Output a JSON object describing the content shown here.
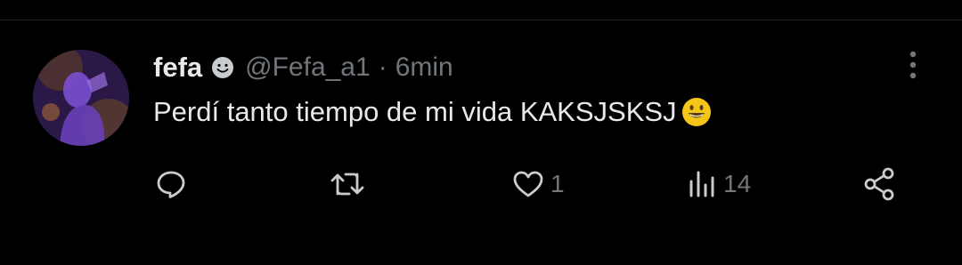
{
  "tweet": {
    "author": {
      "display_name": "fefa",
      "handle": "@Fefa_a1",
      "separator": "·",
      "time": "6min",
      "badge_icon": "smiley-badge-icon",
      "avatar": "avatar-image"
    },
    "text": "Perdí tanto tiempo de mi vida KAKSJSKSJ",
    "emoji": "grinning-face-emoji",
    "actions": {
      "reply": {
        "icon": "reply-icon",
        "count": ""
      },
      "retweet": {
        "icon": "retweet-icon",
        "count": ""
      },
      "like": {
        "icon": "heart-icon",
        "count": "1"
      },
      "views": {
        "icon": "views-icon",
        "count": "14"
      },
      "share": {
        "icon": "share-icon",
        "count": ""
      }
    },
    "more_icon": "more-vertical-icon"
  },
  "colors": {
    "background": "#000000",
    "primary_text": "#e7e9ea",
    "secondary_text": "#71767b",
    "divider": "#1f2327",
    "emoji_yellow": "#f5c518"
  }
}
